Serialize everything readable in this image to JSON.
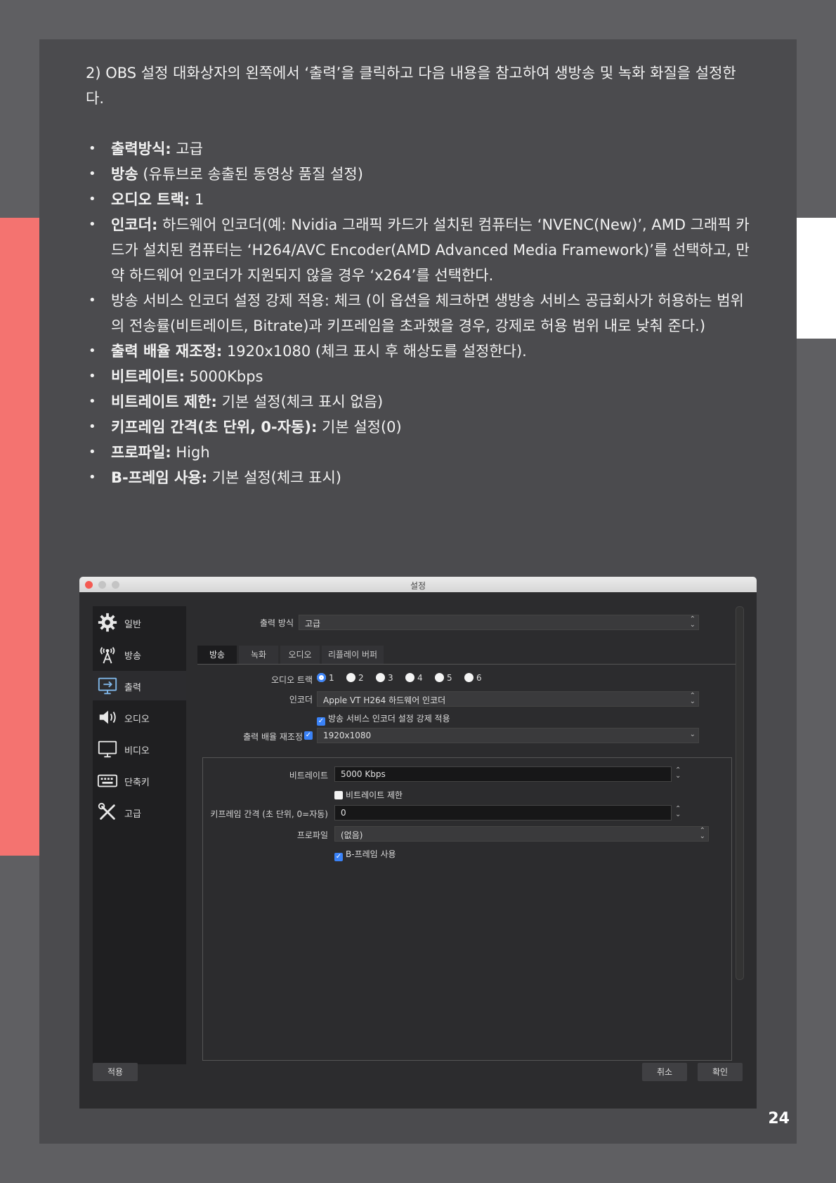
{
  "intro": "2) OBS 설정 대화상자의 왼쪽에서 ‘출력’을 클릭하고 다음 내용을 참고하여 생방송 및 녹화 화질을 설정한다.",
  "bullets": [
    {
      "bold": "출력방식:",
      "text": " 고급"
    },
    {
      "bold": "방송",
      "text": " (유튜브로 송출된 동영상 품질 설정)"
    },
    {
      "bold": "오디오 트랙:",
      "text": " 1"
    },
    {
      "bold": "인코더:",
      "text": " 하드웨어 인코더(예: Nvidia 그래픽 카드가 설치된 컴퓨터는 ‘NVENC(New)’, AMD 그래픽 카드가 설치된 컴퓨터는 ‘H264/AVC Encoder(AMD Advanced Media Framework)’를 선택하고, 만약 하드웨어 인코더가 지원되지 않을 경우 ‘x264’를 선택한다."
    },
    {
      "bold": "",
      "text": " 방송 서비스 인코더 설정 강제 적용: 체크 (이 옵션을 체크하면 생방송 서비스 공급회사가 허용하는 범위의 전송률(비트레이트, Bitrate)과 키프레임을 초과했을 경우, 강제로 허용 범위 내로 낮춰 준다.)"
    },
    {
      "bold": "출력 배율 재조정:",
      "text": " 1920x1080 (체크 표시 후 해상도를 설정한다)."
    },
    {
      "bold": "비트레이트:",
      "text": " 5000Kbps"
    },
    {
      "bold": "비트레이트 제한:",
      "text": " 기본 설정(체크 표시 없음)"
    },
    {
      "bold": "키프레임 간격(초 단위, 0-자동):",
      "text": " 기본 설정(0)"
    },
    {
      "bold": "프로파일:",
      "text": " High"
    },
    {
      "bold": "B-프레임 사용:",
      "text": " 기본 설정(체크 표시)"
    }
  ],
  "window": {
    "title": "설정",
    "sidebar": [
      "일반",
      "방송",
      "출력",
      "오디오",
      "비디오",
      "단축키",
      "고급"
    ],
    "output_mode_label": "출력 방식",
    "output_mode_value": "고급",
    "tabs": [
      "방송",
      "녹화",
      "오디오",
      "리플레이 버퍼"
    ],
    "audio_track_label": "오디오 트랙",
    "audio_tracks": [
      "1",
      "2",
      "3",
      "4",
      "5",
      "6"
    ],
    "encoder_label": "인코더",
    "encoder_value": "Apple VT H264 하드웨어 인코더",
    "enforce_label": "방송 서비스 인코더 설정 강제 적용",
    "rescale_label": "출력 배율 재조정",
    "rescale_value": "1920x1080",
    "bitrate_label": "비트레이트",
    "bitrate_value": "5000 Kbps",
    "bitrate_limit_label": "비트레이트 제한",
    "keyframe_label": "키프레임 간격 (초 단위, 0=자동)",
    "keyframe_value": "0",
    "profile_label": "프로파일",
    "profile_value": "(없음)",
    "bframes_label": "B-프레임 사용",
    "apply_button": "적용",
    "cancel_button": "취소",
    "ok_button": "확인"
  },
  "page_number": "24",
  "colors": {
    "accent": "#f47370",
    "panel": "#4b4b4e",
    "background": "#5f5f62",
    "selected_blue": "#3a82f7"
  }
}
